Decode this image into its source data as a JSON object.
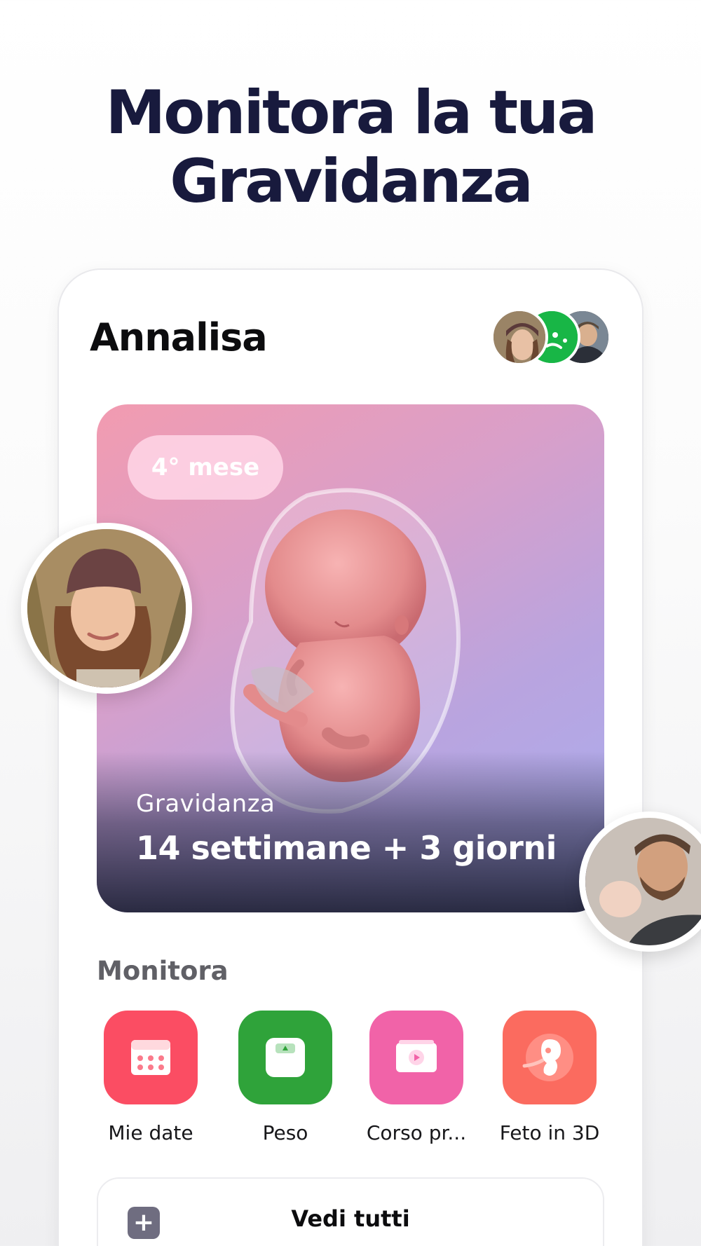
{
  "headline": {
    "line1": "Monitora la tua",
    "line2": "Gravidanza"
  },
  "profile": {
    "name": "Annalisa"
  },
  "hero": {
    "badge": "4° mese",
    "label": "Gravidanza",
    "value": "14 settimane + 3 giorni"
  },
  "monitor": {
    "title": "Monitora",
    "items": [
      {
        "label": "Mie date",
        "icon": "calendar-icon",
        "color": "#fb4d63"
      },
      {
        "label": "Peso",
        "icon": "scale-icon",
        "color": "#2fa33a"
      },
      {
        "label": "Corso pr...",
        "icon": "video-icon",
        "color": "#f163a8"
      },
      {
        "label": "Feto in 3D",
        "icon": "fetus-icon",
        "color": "#fb6b5f"
      }
    ]
  },
  "see_all": {
    "label": "Vedi tutti"
  }
}
